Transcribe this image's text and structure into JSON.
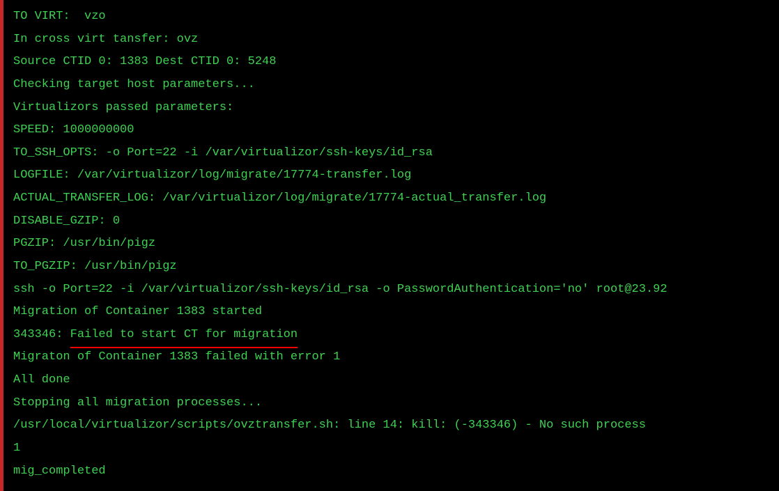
{
  "terminal": {
    "lines": [
      {
        "text": "TO VIRT:  vzo",
        "name": "log-line-to-virt"
      },
      {
        "text": "In cross virt tansfer: ovz",
        "name": "log-line-cross-virt"
      },
      {
        "text": "Source CTID 0: 1383 Dest CTID 0: 5248",
        "name": "log-line-ctid"
      },
      {
        "text": "Checking target host parameters...",
        "name": "log-line-checking"
      },
      {
        "text": "Virtualizors passed parameters:",
        "name": "log-line-params-header"
      },
      {
        "text": "SPEED: 1000000000",
        "name": "log-line-speed"
      },
      {
        "text": "TO_SSH_OPTS: -o Port=22 -i /var/virtualizor/ssh-keys/id_rsa",
        "name": "log-line-ssh-opts"
      },
      {
        "text": "LOGFILE: /var/virtualizor/log/migrate/17774-transfer.log",
        "name": "log-line-logfile"
      },
      {
        "text": "ACTUAL_TRANSFER_LOG: /var/virtualizor/log/migrate/17774-actual_transfer.log",
        "name": "log-line-actual-log"
      },
      {
        "text": "DISABLE_GZIP: 0",
        "name": "log-line-disable-gzip"
      },
      {
        "text": "PGZIP: /usr/bin/pigz",
        "name": "log-line-pgzip"
      },
      {
        "text": "TO_PGZIP: /usr/bin/pigz",
        "name": "log-line-to-pgzip"
      },
      {
        "text": "ssh -o Port=22 -i /var/virtualizor/ssh-keys/id_rsa -o PasswordAuthentication='no' root@23.92",
        "name": "log-line-ssh-cmd"
      },
      {
        "text": "Migration of Container 1383 started",
        "name": "log-line-migration-started"
      },
      {
        "text": "343346: ",
        "underlined": "Failed to start CT for migration",
        "name": "log-line-error"
      },
      {
        "text": "Migraton of Container 1383 failed with error 1",
        "name": "log-line-migration-failed"
      },
      {
        "text": "All done",
        "name": "log-line-all-done"
      },
      {
        "text": "Stopping all migration processes...",
        "name": "log-line-stopping"
      },
      {
        "text": "/usr/local/virtualizor/scripts/ovztransfer.sh: line 14: kill: (-343346) - No such process",
        "name": "log-line-kill-error"
      },
      {
        "text": "1",
        "name": "log-line-exit-code"
      },
      {
        "text": "mig_completed",
        "name": "log-line-mig-completed"
      }
    ]
  }
}
